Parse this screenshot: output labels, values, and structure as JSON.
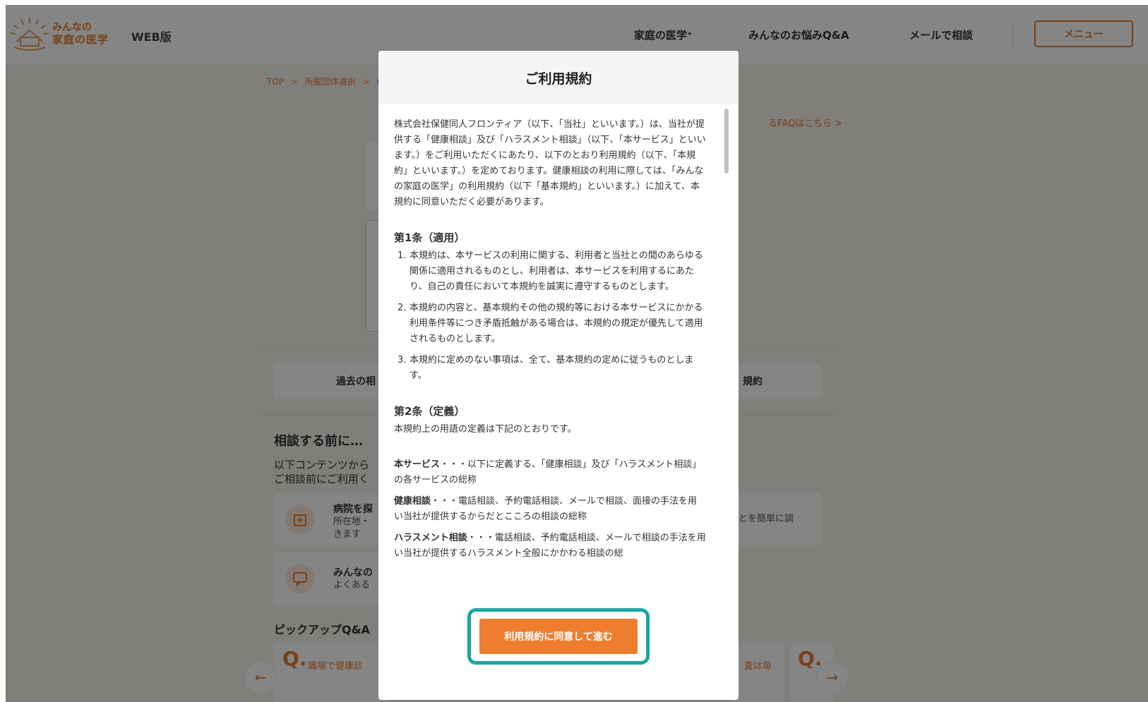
{
  "header": {
    "logo_line1": "みんなの",
    "logo_line2": "家庭の医学",
    "web_label": "WEB版",
    "nav": [
      "家庭の医学⁺",
      "みんなのお悩みQ&A",
      "メールで相談"
    ],
    "menu_label": "メニュー"
  },
  "background": {
    "breadcrumb": [
      "TOP",
      ">",
      "所属団体選択",
      ">",
      "健康"
    ],
    "faq_link": "るFAQはこちら >",
    "tab_left": "過去の相",
    "tab_right": "規約",
    "section_before": "相談する前に…",
    "section_before_text1": "以下コンテンツから",
    "section_before_text2": "ご相談前にご利用く",
    "svc1_title": "病院を探",
    "svc1_desc1": "所在地・",
    "svc1_desc2": "きます",
    "svc1_right": "とを簡単に調",
    "svc2_title": "みんなの",
    "svc2_desc": "よくある",
    "pickup_title": "ピックアップQ&A",
    "qa1_text": "職場で健康診",
    "qa2_text": "査は毎"
  },
  "modal": {
    "title": "ご利用規約",
    "intro": "株式会社保健同人フロンティア（以下、「当社」といいます。）は、当社が提供する「健康相談」及び「ハラスメント相談」（以下、「本サービス」といいます。）をご利用いただくにあたり、以下のとおり利用規約（以下、「本規約」といいます。）を定めております。健康相談の利用に際しては、「みんなの家庭の医学」の利用規約（以下「基本規約」といいます。）に加えて、本規約に同意いただく必要があります。",
    "article1_title": "第1条（適用）",
    "article1_items": [
      {
        "num": "1.",
        "text": "本規約は、本サービスの利用に関する、利用者と当社との間のあらゆる関係に適用されるものとし、利用者は、本サービスを利用するにあたり、自己の責任において本規約を誠実に遵守するものとします。"
      },
      {
        "num": "2.",
        "text": "本規約の内容と、基本規約その他の規約等における本サービスにかかる利用条件等につき矛盾抵触がある場合は、本規約の規定が優先して適用されるものとします。"
      },
      {
        "num": "3.",
        "text": "本規約に定めのない事項は、全て、基本規約の定めに従うものとします。"
      }
    ],
    "article2_title": "第2条（定義）",
    "article2_intro": "本規約上の用語の定義は下記のとおりです。",
    "definitions": [
      {
        "term": "本サービス",
        "text": "・・・以下に定義する、「健康相談」及び「ハラスメント相談」の各サービスの総称"
      },
      {
        "term": "健康相談",
        "text": "・・・電話相談、予約電話相談、メールで相談、面接の手法を用い当社が提供するからだとこころの相談の総称"
      },
      {
        "term": "ハラスメント相談",
        "text": "・・・電話相談、予約電話相談、メールで相談の手法を用い当社が提供するハラスメント全般にかかわる相談の総"
      }
    ],
    "agree_label": "利用規約に同意して進む"
  },
  "colors": {
    "accent": "#ef7d2f",
    "highlight": "#1aa7a0"
  }
}
